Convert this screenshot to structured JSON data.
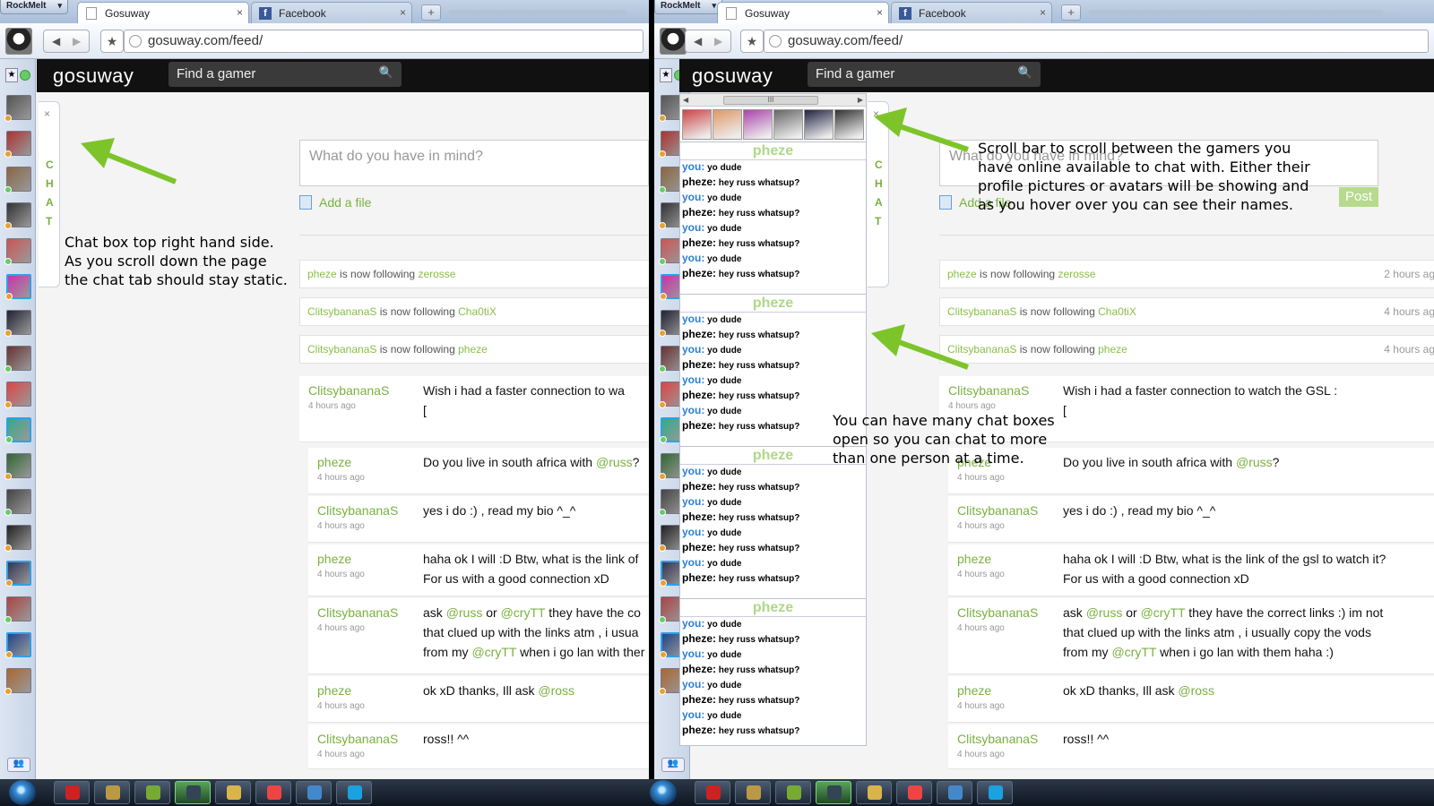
{
  "browser": {
    "app_menu": "RockMelt",
    "tabs": [
      {
        "label": "Gosuway",
        "close": "×"
      },
      {
        "label": "Facebook",
        "close": "×"
      }
    ],
    "facebook_glyph": "f",
    "new_tab": "+",
    "back": "◀",
    "forward": "▶",
    "star": "★",
    "url": "gosuway.com/feed/",
    "friends_button": "👥"
  },
  "site": {
    "logo": "gosuway",
    "search_placeholder": "Find a gamer",
    "search_icon": "🔍",
    "composer_placeholder": "What do you have in mind?",
    "add_file": "Add a file",
    "post_button": "Post",
    "chat_tab": {
      "close": "×",
      "letters": [
        "C",
        "H",
        "A",
        "T"
      ]
    }
  },
  "activity": [
    {
      "user": "pheze",
      "action": "is now following",
      "target": "zerosse",
      "time": "2 hours ag"
    },
    {
      "user": "ClitsybananaS",
      "action": "is now following",
      "target": "Cha0tiX",
      "time": "4 hours ag"
    },
    {
      "user": "ClitsybananaS",
      "action": "is now following",
      "target": "pheze",
      "time": "4 hours ag"
    }
  ],
  "posts_left": [
    {
      "author": "ClitsybananaS",
      "time": "4 hours ago",
      "text": "Wish i had a faster connection to wa\n["
    },
    {
      "author": "pheze",
      "time": "4 hours ago",
      "text_parts": [
        "Do you live in south africa with ",
        "@russ",
        "?"
      ]
    },
    {
      "author": "ClitsybananaS",
      "time": "4 hours ago",
      "text": "yes i do :) , read my bio ^_^"
    },
    {
      "author": "pheze",
      "time": "4 hours ago",
      "text": "haha ok I will :D Btw, what is the link of\nFor us with a good connection xD"
    },
    {
      "author": "ClitsybananaS",
      "time": "4 hours ago",
      "text_parts": [
        "ask ",
        "@russ",
        " or ",
        "@cryTT",
        " they have the co\nthat clued up with the links atm , i usua\nfrom my ",
        "@cryTT",
        " when i go lan with ther"
      ]
    },
    {
      "author": "pheze",
      "time": "4 hours ago",
      "text_parts": [
        "ok xD thanks, Ill ask ",
        "@ross",
        ""
      ]
    },
    {
      "author": "ClitsybananaS",
      "time": "4 hours ago",
      "text": "ross!! ^^"
    }
  ],
  "posts_right": [
    {
      "author": "ClitsybananaS",
      "time": "4 hours ago",
      "text": "Wish i had a faster connection to watch the GSL :\n["
    },
    {
      "author": "pheze",
      "time": "4 hours ago",
      "text_parts": [
        "Do you live in south africa with ",
        "@russ",
        "?"
      ]
    },
    {
      "author": "ClitsybananaS",
      "time": "4 hours ago",
      "text": "yes i do :) , read my bio ^_^"
    },
    {
      "author": "pheze",
      "time": "4 hours ago",
      "text": "haha ok I will :D Btw, what is the link of the gsl to watch it?\nFor us with a good connection xD"
    },
    {
      "author": "ClitsybananaS",
      "time": "4 hours ago",
      "text_parts": [
        "ask ",
        "@russ",
        " or ",
        "@cryTT",
        " they have the correct links :) im not\nthat clued up with the links atm , i usually copy the vods\nfrom my ",
        "@cryTT",
        " when i go lan with them haha :)"
      ]
    },
    {
      "author": "pheze",
      "time": "4 hours ago",
      "text_parts": [
        "ok xD thanks, Ill ask ",
        "@ross",
        ""
      ]
    },
    {
      "author": "ClitsybananaS",
      "time": "4 hours ago",
      "text": "ross!! ^^"
    }
  ],
  "chat": {
    "scroll_thumb": "III",
    "scroll_left": "◀",
    "scroll_right": "▶",
    "boxes": [
      {
        "title": "pheze"
      },
      {
        "title": "pheze"
      },
      {
        "title": "pheze"
      },
      {
        "title": "pheze"
      }
    ],
    "messages": [
      {
        "who": "you:",
        "text": "yo dude"
      },
      {
        "who": "pheze:",
        "text": "hey russ whatsup?"
      },
      {
        "who": "you:",
        "text": "yo dude"
      },
      {
        "who": "pheze:",
        "text": "hey russ whatsup?"
      },
      {
        "who": "you:",
        "text": "yo dude"
      },
      {
        "who": "pheze:",
        "text": "hey russ whatsup?"
      },
      {
        "who": "you:",
        "text": "yo dude"
      },
      {
        "who": "pheze:",
        "text": "hey russ whatsup?"
      }
    ]
  },
  "annotations": {
    "chat_tab_note": "Chat box top right hand side.\nAs you scroll down the page\nthe chat tab should stay static.",
    "scroll_note": "Scroll bar to scroll between the gamers you\nhave online available to chat with. Either their\nprofile pictures or avatars will be showing and\nas you hover over you can see their names.",
    "multi_chat_note": "You can have many chat boxes\nopen so you can chat to more\nthan one person at a time."
  },
  "colors": {
    "accent_green": "#7ab040",
    "arrow_green": "#7dc42a",
    "you_blue": "#2a7fd4",
    "header_black": "#111111"
  },
  "icons": {
    "taskbar": [
      "start-orb-icon",
      "acrobat-icon",
      "winamp-icon",
      "utorrent-icon",
      "steam-icon",
      "explorer-icon",
      "chrome-icon",
      "rockmelt-icon",
      "skype-icon"
    ]
  }
}
